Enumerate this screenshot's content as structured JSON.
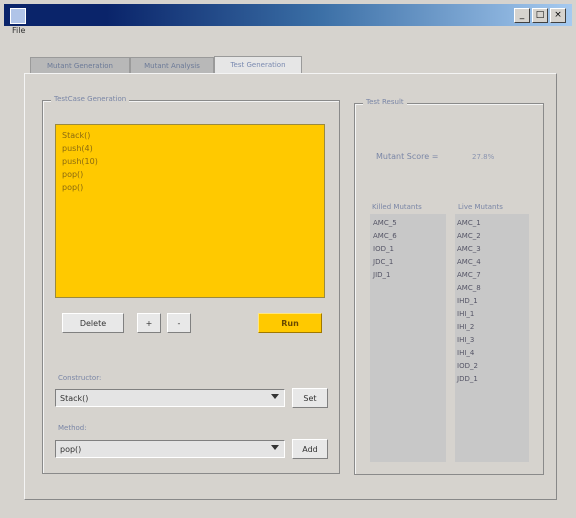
{
  "window": {
    "controls": [
      "_",
      "□",
      "×"
    ]
  },
  "menu": {
    "file": "File"
  },
  "tabs": [
    "Mutant Generation",
    "Mutant Analysis",
    "Test Generation"
  ],
  "test_case_group": {
    "title": "TestCase Generation",
    "sequence": [
      "Stack()",
      "push(4)",
      "push(10)",
      "pop()",
      "pop()"
    ],
    "buttons": {
      "delete": "Delete",
      "plus": "+",
      "minus": "-",
      "run": "Run"
    },
    "constructor_label": "Constructor:",
    "constructor_value": "Stack()",
    "set": "Set",
    "method_label": "Method:",
    "method_value": "pop()",
    "add": "Add"
  },
  "test_result_group": {
    "title": "Test Result",
    "score_label": "Mutant Score =",
    "score_value": "27.8%",
    "killed_header": "Killed Mutants",
    "live_header": "Live Mutants",
    "killed": [
      "AMC_5",
      "AMC_6",
      "IOD_1",
      "JDC_1",
      "JID_1"
    ],
    "live": [
      "AMC_1",
      "AMC_2",
      "AMC_3",
      "AMC_4",
      "AMC_7",
      "AMC_8",
      "IHD_1",
      "IHI_1",
      "IHI_2",
      "IHI_3",
      "IHI_4",
      "IOD_2",
      "JDD_1"
    ]
  }
}
